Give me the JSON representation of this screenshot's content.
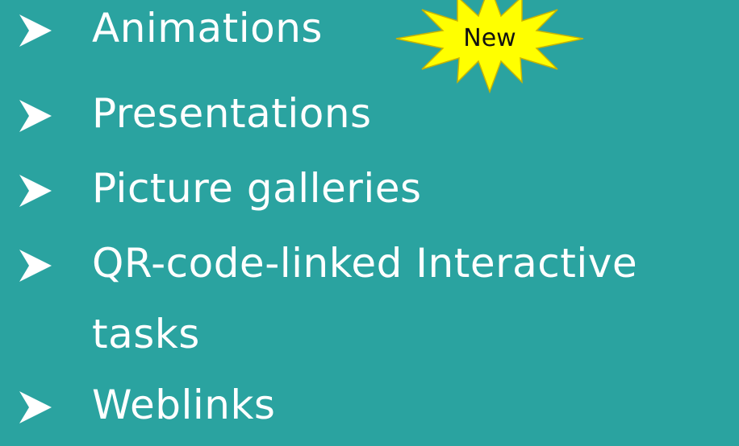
{
  "slide": {
    "background_color": "#2aa3a0",
    "text_color": "#ffffff",
    "bullet_icon": "arrow-bullet-icon",
    "items": [
      {
        "label": "Animations"
      },
      {
        "label": "Presentations"
      },
      {
        "label": "Picture galleries"
      },
      {
        "label_line1": "QR-code-linked Interactive",
        "label_line2": "tasks"
      },
      {
        "label": "Weblinks"
      }
    ],
    "badge": {
      "text": "New",
      "shape": "starburst-icon",
      "fill_color": "#ffff00",
      "stroke_color": "#c9b400",
      "text_color": "#111111"
    }
  }
}
